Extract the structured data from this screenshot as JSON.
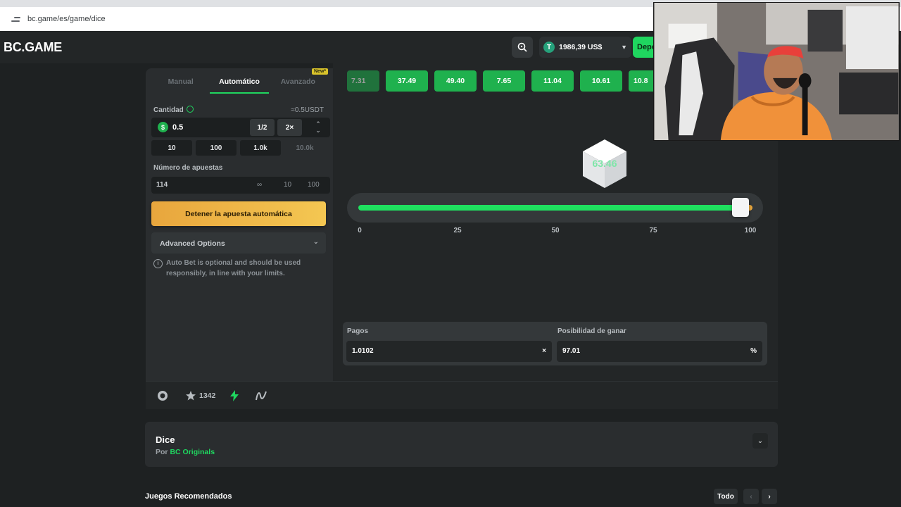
{
  "browser": {
    "url": "bc.game/es/game/dice"
  },
  "header": {
    "logo": "BC.GAME",
    "currency_symbol": "T",
    "balance": "1986,39 US$",
    "deposit_label": "Depo"
  },
  "panel": {
    "tabs": [
      {
        "label": "Manual",
        "active": false
      },
      {
        "label": "Automático",
        "active": true
      },
      {
        "label": "Avanzado",
        "active": false
      }
    ],
    "new_badge": "New*",
    "amount_label": "Cantidad",
    "amount_usdt": "≈0.5USDT",
    "amount_value": "0.5",
    "half_label": "1/2",
    "double_label": "2×",
    "quick_amounts": [
      "10",
      "100",
      "1.0k",
      "10.0k"
    ],
    "bets_label": "Número de apuestas",
    "bets_value": "114",
    "bets_options": [
      "∞",
      "10",
      "100"
    ],
    "stop_label": "Detener la apuesta automática",
    "advanced_label": "Advanced Options",
    "note_line1": "Auto Bet is optional and should be used",
    "note_line2": "responsibly, in line with your limits."
  },
  "game": {
    "history": [
      "7.31",
      "37.49",
      "49.40",
      "7.65",
      "11.04",
      "10.61",
      "10.8"
    ],
    "result": "63.46",
    "slider_value": 97.01,
    "ticks": [
      "0",
      "25",
      "50",
      "75",
      "100"
    ],
    "payout_label": "Pagos",
    "payout_value": "1.0102",
    "payout_suffix": "×",
    "chance_label": "Posibilidad de ganar",
    "chance_value": "97.01",
    "chance_suffix": "%"
  },
  "toolbar": {
    "favorites": "1342"
  },
  "info": {
    "title": "Dice",
    "by": "Por",
    "provider": "BC Originals"
  },
  "recommended": {
    "title": "Juegos Recomendados",
    "all_label": "Todo"
  },
  "colors": {
    "accent": "#1fd65f",
    "stop_button": "#f4c752",
    "chip": "#1fb14e"
  }
}
